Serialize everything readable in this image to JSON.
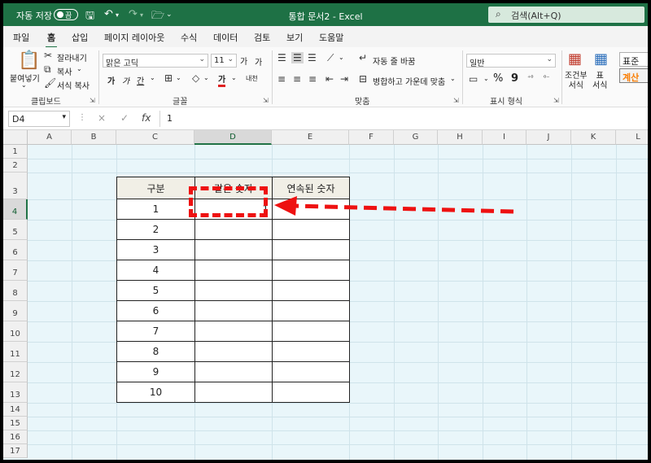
{
  "titlebar": {
    "autosave_label": "자동 저장",
    "autosave_state": "끔",
    "document_title": "통합 문서2  -  Excel",
    "search_label": "검색(Alt+Q)"
  },
  "tabs": [
    "파일",
    "홈",
    "삽입",
    "페이지 레이아웃",
    "수식",
    "데이터",
    "검토",
    "보기",
    "도움말"
  ],
  "active_tab": "홈",
  "ribbon": {
    "clipboard": {
      "paste_label": "붙여넣기",
      "cut_label": "잘라내기",
      "copy_label": "복사",
      "format_painter_label": "서식 복사",
      "group_label": "클립보드"
    },
    "font": {
      "font_name": "맑은 고딕",
      "font_size": "11",
      "grow_label": "가",
      "shrink_label": "가",
      "bold_label": "가",
      "italic_label": "가",
      "underline_label": "간",
      "font_color_label": "가",
      "phonetic_label": "내천",
      "group_label": "글꼴"
    },
    "alignment": {
      "wrap_label": "자동 줄 바꿈",
      "merge_label": "병합하고 가운데 맞춤",
      "group_label": "맞춤"
    },
    "number": {
      "format": "일반",
      "percent_label": "%",
      "comma_label": "9",
      "group_label": "표시 형식"
    },
    "styles": {
      "conditional_label": "조건부\n서식",
      "table_label": "표\n서식",
      "style_normal": "표준",
      "style_calc": "계산"
    }
  },
  "formula_bar": {
    "name_box": "D4",
    "cancel_icon": "×",
    "enter_icon": "✓",
    "fx_label": "fx",
    "formula": "1"
  },
  "grid": {
    "columns": [
      "A",
      "B",
      "C",
      "D",
      "E",
      "F",
      "G",
      "H",
      "I",
      "J",
      "K",
      "L"
    ],
    "rows": [
      "1",
      "2",
      "3",
      "4",
      "5",
      "6",
      "7",
      "8",
      "9",
      "10",
      "11",
      "12",
      "13",
      "14",
      "15",
      "16",
      "17"
    ],
    "selected_column": "D",
    "selected_row": "4"
  },
  "table": {
    "headers": [
      "구분",
      "같은 숫자",
      "연속된 숫자"
    ],
    "rows": [
      [
        "1",
        "1",
        ""
      ],
      [
        "2",
        "",
        ""
      ],
      [
        "3",
        "",
        ""
      ],
      [
        "4",
        "",
        ""
      ],
      [
        "5",
        "",
        ""
      ],
      [
        "6",
        "",
        ""
      ],
      [
        "7",
        "",
        ""
      ],
      [
        "8",
        "",
        ""
      ],
      [
        "9",
        "",
        ""
      ],
      [
        "10",
        "",
        ""
      ]
    ]
  },
  "colors": {
    "excel_green": "#1e7145",
    "annotation_red": "#e11"
  }
}
